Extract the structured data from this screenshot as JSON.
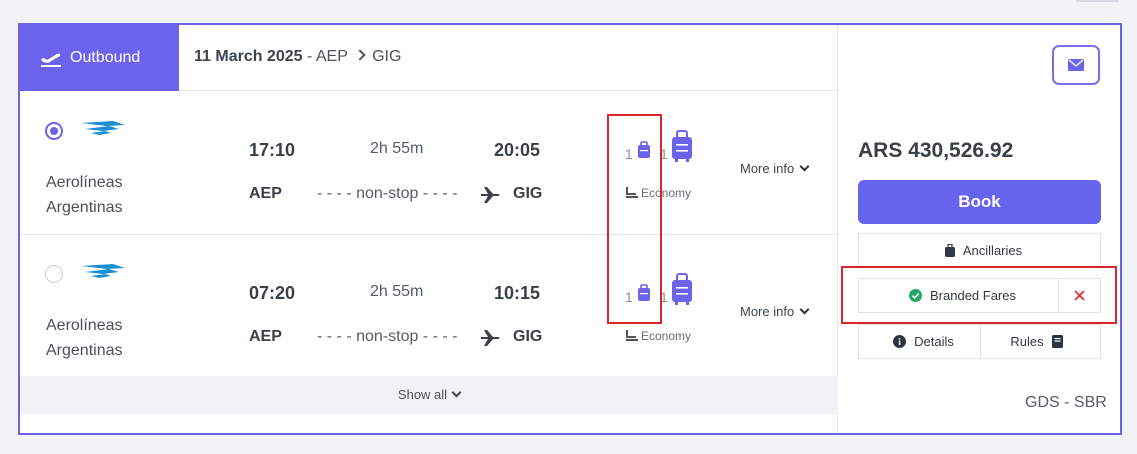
{
  "header": {
    "tab_label": "Outbound",
    "date": "11 March 2025",
    "separator": " - ",
    "origin": "AEP",
    "destination": "GIG"
  },
  "flights": [
    {
      "selected": true,
      "airline": [
        "Aerolíneas",
        "Argentinas"
      ],
      "depart_time": "17:10",
      "duration": "2h 55m",
      "arrive_time": "20:05",
      "from": "AEP",
      "stops": "- - - - non-stop - - - -",
      "to": "GIG",
      "personal_item_count": "1",
      "carry_on_count": "1",
      "cabin": "Economy",
      "more_info": "More info"
    },
    {
      "selected": false,
      "airline": [
        "Aerolíneas",
        "Argentinas"
      ],
      "depart_time": "07:20",
      "duration": "2h 55m",
      "arrive_time": "10:15",
      "from": "AEP",
      "stops": "- - - - non-stop - - - -",
      "to": "GIG",
      "personal_item_count": "1",
      "carry_on_count": "1",
      "cabin": "Economy",
      "more_info": "More info"
    }
  ],
  "show_all": "Show all",
  "sidebar": {
    "price": "ARS 430,526.92",
    "book": "Book",
    "ancillaries": "Ancillaries",
    "branded_fares": "Branded Fares",
    "details": "Details",
    "rules": "Rules",
    "source": "GDS - SBR"
  },
  "colors": {
    "accent": "#6c63ec",
    "highlight": "#d8262c",
    "success": "#22a86a",
    "airline_logo": "#1b8fcf"
  },
  "icons": {
    "tab": "plane-departure-icon",
    "mail": "envelope-icon",
    "bag": "suitcase-icon",
    "info": "info-circle-icon",
    "rules": "book-icon"
  }
}
